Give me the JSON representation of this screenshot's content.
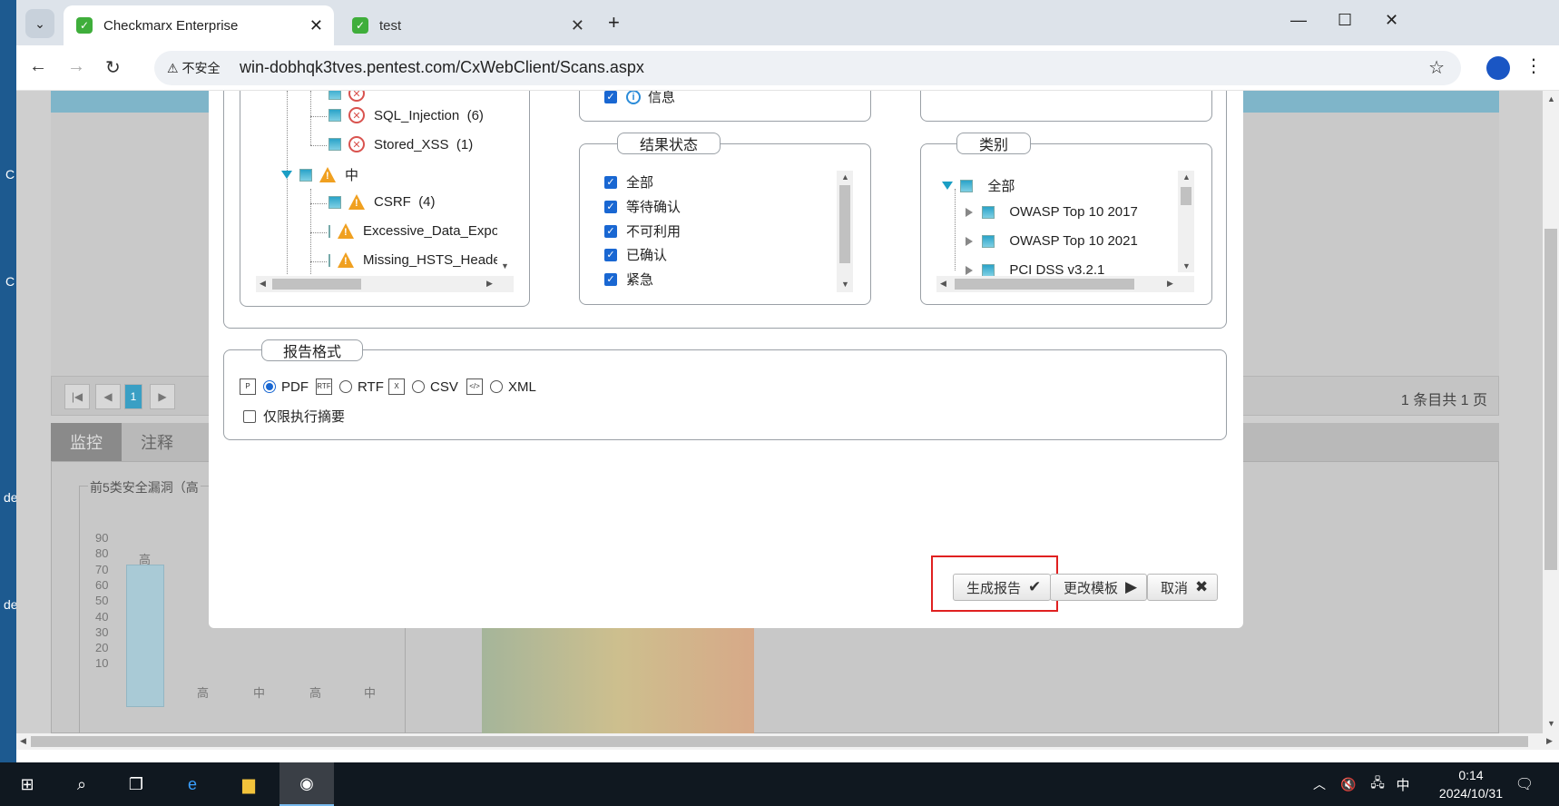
{
  "browser": {
    "tabs": [
      {
        "title": "Checkmarx Enterprise",
        "favicon": "✓"
      },
      {
        "title": "test",
        "favicon": "✓"
      }
    ],
    "security_label": "不安全",
    "url": "win-dobhqk3tves.pentest.com/CxWebClient/Scans.aspx"
  },
  "desktop_chars": [
    "C",
    "C",
    "de",
    "de"
  ],
  "background": {
    "pager": {
      "page": "1",
      "info": "1 条目共 1 页"
    },
    "tabs": [
      "监控",
      "注释"
    ],
    "chart_title": "前5类安全漏洞（高",
    "chart_data": {
      "type": "bar",
      "yticks": [
        "90",
        "80",
        "70",
        "60",
        "50",
        "40",
        "30",
        "20",
        "10"
      ],
      "ylim": [
        0,
        90
      ],
      "bar_labels": [
        "高",
        "高",
        "中",
        "高",
        "中"
      ],
      "values": [
        73
      ]
    }
  },
  "dialog": {
    "tree_items": [
      {
        "label": "SQL_Injection",
        "count": "(6)",
        "icon": "error-icon"
      },
      {
        "label": "Stored_XSS",
        "count": "(1)",
        "icon": "error-icon"
      },
      {
        "label": "中",
        "count": "",
        "icon": "warning-icon"
      },
      {
        "label": "CSRF",
        "count": "(4)",
        "icon": "warning-icon"
      },
      {
        "label": "Excessive_Data_Expo",
        "count": "",
        "icon": "warning-icon"
      },
      {
        "label": "Missing_HSTS_Heade",
        "count": "",
        "icon": "warning-icon"
      }
    ],
    "info_label": "信息",
    "result_status": {
      "legend": "结果状态",
      "items": [
        "全部",
        "等待确认",
        "不可利用",
        "已确认",
        "紧急"
      ]
    },
    "category": {
      "legend": "类别",
      "root": "全部",
      "items": [
        "OWASP Top 10 2017",
        "OWASP Top 10 2021",
        "PCI DSS v3.2.1"
      ]
    },
    "report_format": {
      "legend": "报告格式",
      "options": [
        "PDF",
        "RTF",
        "CSV",
        "XML"
      ],
      "selected": "PDF",
      "summary_only": "仅限执行摘要"
    },
    "buttons": {
      "generate": "生成报告",
      "change_template": "更改模板",
      "cancel": "取消"
    }
  },
  "taskbar": {
    "time": "0:14",
    "date": "2024/10/31",
    "ime": "中"
  }
}
